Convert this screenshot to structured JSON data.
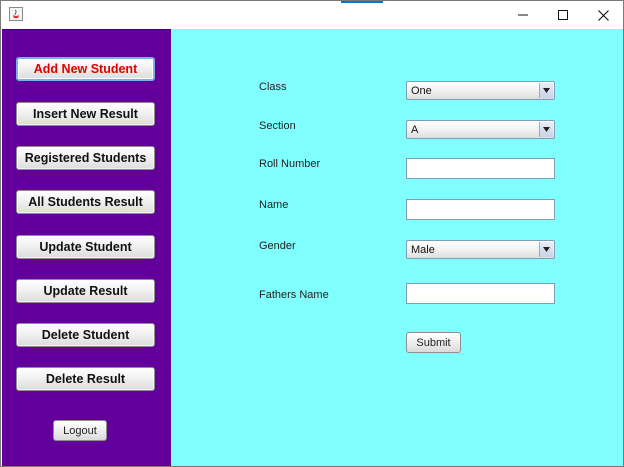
{
  "sidebar": {
    "buttons": [
      {
        "label": "Add New Student",
        "active": true
      },
      {
        "label": "Insert New Result"
      },
      {
        "label": "Registered Students"
      },
      {
        "label": "All Students Result"
      },
      {
        "label": "Update Student"
      },
      {
        "label": "Update Result"
      },
      {
        "label": "Delete Student"
      },
      {
        "label": "Delete Result"
      }
    ],
    "logout_label": "Logout"
  },
  "form": {
    "class_label": "Class",
    "class_value": "One",
    "section_label": "Section",
    "section_value": "A",
    "roll_label": "Roll Number",
    "roll_value": "",
    "name_label": "Name",
    "name_value": "",
    "gender_label": "Gender",
    "gender_value": "Male",
    "father_label": "Fathers Name",
    "father_value": "",
    "submit_label": "Submit"
  },
  "colors": {
    "sidebar_bg": "#63009b",
    "main_bg": "#80ffff",
    "active_text": "#e10000"
  }
}
